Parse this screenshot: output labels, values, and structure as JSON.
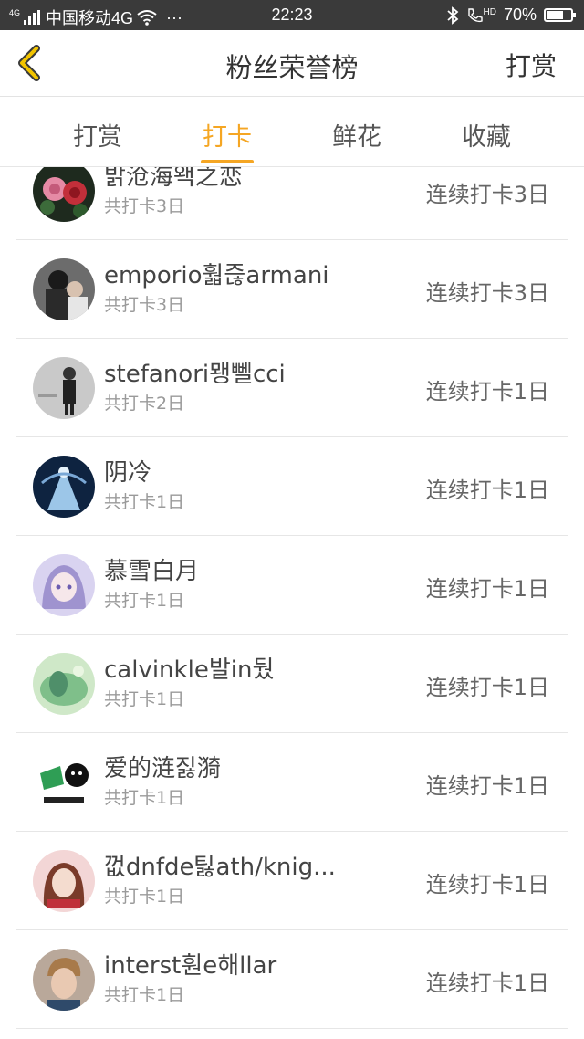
{
  "status_bar": {
    "network_type": "4G",
    "carrier": "中国移动4G",
    "more": "···",
    "time": "22:23",
    "hd": "HD",
    "battery": "70%",
    "battery_level": 0.7
  },
  "header": {
    "title": "粉丝荣誉榜",
    "action": "打赏"
  },
  "tabs": [
    {
      "label": "打赏",
      "active": false
    },
    {
      "label": "打卡",
      "active": true
    },
    {
      "label": "鲜花",
      "active": false
    },
    {
      "label": "收藏",
      "active": false
    }
  ],
  "list": [
    {
      "name": "밝沧海왝之恋",
      "total": "共打卡3日",
      "streak": "连续打卡3日",
      "avatar": "roses"
    },
    {
      "name": "emporio훫즎armani",
      "total": "共打卡3日",
      "streak": "连续打卡3日",
      "avatar": "dark-couple"
    },
    {
      "name": "stefanori뫵뻴cci",
      "total": "共打卡2日",
      "streak": "连续打卡1日",
      "avatar": "grey-figure"
    },
    {
      "name": "阴冷",
      "total": "共打卡1日",
      "streak": "连续打卡1日",
      "avatar": "blue-angel"
    },
    {
      "name": "慕雪白月",
      "total": "共打卡1日",
      "streak": "连续打卡1日",
      "avatar": "anime-girl"
    },
    {
      "name": "calvinkle발in뒀",
      "total": "共打卡1日",
      "streak": "连续打卡1日",
      "avatar": "green-nature"
    },
    {
      "name": "爱的涟짏漪",
      "total": "共打卡1日",
      "streak": "连续打卡1日",
      "avatar": "cartoon-flag"
    },
    {
      "name": "껎dnfde틿ath/knig...",
      "total": "共打卡1日",
      "streak": "连续打卡1日",
      "avatar": "pink-girl"
    },
    {
      "name": "interst훤e해llar",
      "total": "共打卡1日",
      "streak": "连续打卡1日",
      "avatar": "boy-portrait"
    }
  ],
  "colors": {
    "accent": "#f5a623",
    "back_arrow": "#f2c400",
    "status_bar_bg": "#3a3a3a"
  },
  "icons": {
    "back": "chevron-left-icon",
    "wifi": "wifi-icon",
    "bluetooth": "bluetooth-icon",
    "call": "hd-call-icon",
    "battery": "battery-icon"
  }
}
